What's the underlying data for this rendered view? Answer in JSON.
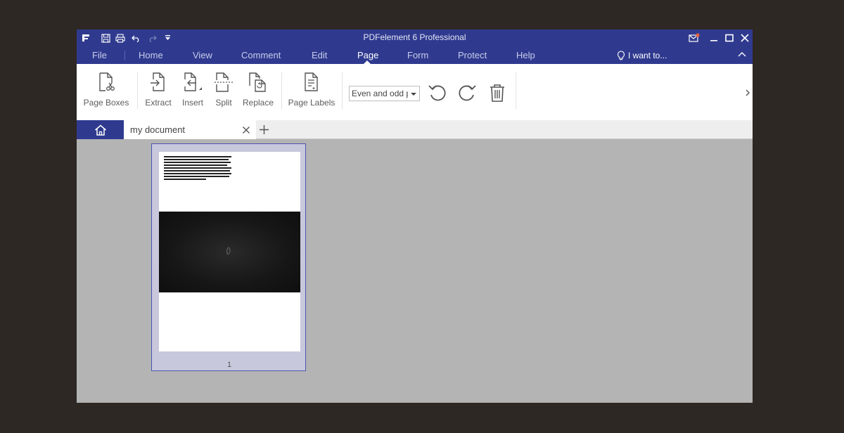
{
  "window": {
    "title": "PDFelement 6 Professional"
  },
  "menu": {
    "items": [
      "File",
      "Home",
      "View",
      "Comment",
      "Edit",
      "Page",
      "Form",
      "Protect",
      "Help"
    ],
    "active": "Page",
    "search_label": "I want to..."
  },
  "ribbon": {
    "page_boxes": "Page Boxes",
    "extract": "Extract",
    "insert": "Insert",
    "split": "Split",
    "replace": "Replace",
    "page_labels": "Page Labels",
    "page_range_value": "Even and odd pages"
  },
  "tabs": {
    "document_name": "my document"
  },
  "thumbnails": [
    {
      "page_number": "1"
    }
  ],
  "colors": {
    "brand": "#2f3a8f",
    "background": "#2e2825",
    "canvas": "#b4b4b4",
    "selection": "#4b55b0"
  }
}
